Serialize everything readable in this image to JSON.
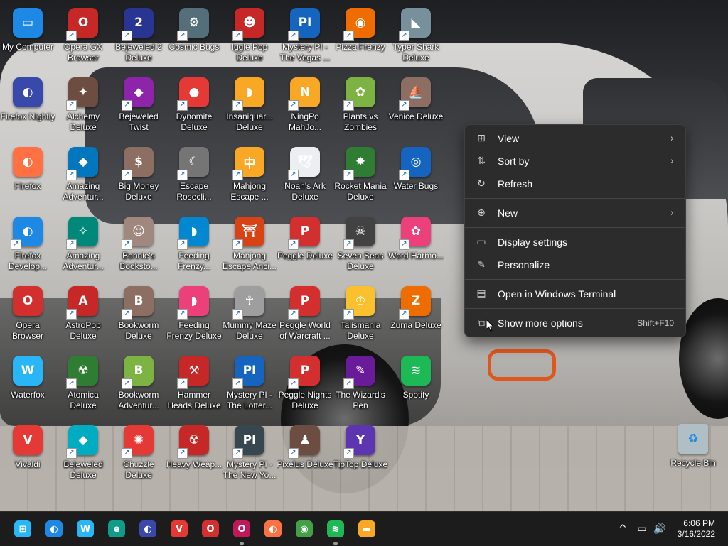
{
  "desktop": {
    "icons": [
      {
        "label": "My Computer",
        "color": "#1e88e5",
        "glyph": "▭",
        "shortcut": false
      },
      {
        "label": "Opera GX Browser",
        "color": "#c62828",
        "glyph": "O",
        "shortcut": true
      },
      {
        "label": "Bejeweled 2 Deluxe",
        "color": "#283593",
        "glyph": "2",
        "shortcut": true
      },
      {
        "label": "Cosmic Bugs",
        "color": "#546e7a",
        "glyph": "⚙",
        "shortcut": true
      },
      {
        "label": "Iggle Pop Deluxe",
        "color": "#c62828",
        "glyph": "☻",
        "shortcut": true
      },
      {
        "label": "Mystery PI - The Vegas ...",
        "color": "#1565c0",
        "glyph": "PI",
        "shortcut": true
      },
      {
        "label": "Pizza Frenzy",
        "color": "#ef6c00",
        "glyph": "◉",
        "shortcut": true
      },
      {
        "label": "Typer Shark Deluxe",
        "color": "#78909c",
        "glyph": "◣",
        "shortcut": true
      },
      {
        "label": "Firefox Nightly",
        "color": "#3949ab",
        "glyph": "◐",
        "shortcut": false
      },
      {
        "label": "Alchemy Deluxe",
        "color": "#6d4c41",
        "glyph": "✦",
        "shortcut": true
      },
      {
        "label": "Bejeweled Twist",
        "color": "#8e24aa",
        "glyph": "◆",
        "shortcut": true
      },
      {
        "label": "Dynomite Deluxe",
        "color": "#e53935",
        "glyph": "●",
        "shortcut": true
      },
      {
        "label": "Insaniquar... Deluxe",
        "color": "#f9a825",
        "glyph": "◗",
        "shortcut": true
      },
      {
        "label": "NingPo MahJo...",
        "color": "#f9a825",
        "glyph": "N",
        "shortcut": true
      },
      {
        "label": "Plants vs Zombies",
        "color": "#7cb342",
        "glyph": "✿",
        "shortcut": true
      },
      {
        "label": "Venice Deluxe",
        "color": "#8d6e63",
        "glyph": "⛵",
        "shortcut": true
      },
      {
        "label": "Firefox",
        "color": "#ff7043",
        "glyph": "◐",
        "shortcut": false
      },
      {
        "label": "Amazing Adventur...",
        "color": "#0277bd",
        "glyph": "◆",
        "shortcut": true
      },
      {
        "label": "Big Money Deluxe",
        "color": "#8d6e63",
        "glyph": "$",
        "shortcut": true
      },
      {
        "label": "Escape Rosecli...",
        "color": "#757575",
        "glyph": "☾",
        "shortcut": true
      },
      {
        "label": "Mahjong Escape ...",
        "color": "#f9a825",
        "glyph": "中",
        "shortcut": true
      },
      {
        "label": "Noah's Ark Deluxe",
        "color": "#eceff1",
        "glyph": "🕊",
        "shortcut": true
      },
      {
        "label": "Rocket Mania Deluxe",
        "color": "#2e7d32",
        "glyph": "✸",
        "shortcut": true
      },
      {
        "label": "Water Bugs",
        "color": "#1565c0",
        "glyph": "◎",
        "shortcut": true
      },
      {
        "label": "Firefox Develop...",
        "color": "#1e88e5",
        "glyph": "◐",
        "shortcut": true
      },
      {
        "label": "Amazing Adventur...",
        "color": "#00897b",
        "glyph": "✧",
        "shortcut": true
      },
      {
        "label": "Bonnie's Bookstо...",
        "color": "#a1887f",
        "glyph": "☺",
        "shortcut": true
      },
      {
        "label": "Feeding Frenzy...",
        "color": "#0288d1",
        "glyph": "◗",
        "shortcut": true
      },
      {
        "label": "Mahjong Escape Anci...",
        "color": "#d84315",
        "glyph": "⛩",
        "shortcut": true
      },
      {
        "label": "Peggle Deluxe",
        "color": "#d32f2f",
        "glyph": "P",
        "shortcut": true
      },
      {
        "label": "Seven Seas Deluxe",
        "color": "#424242",
        "glyph": "☠",
        "shortcut": true
      },
      {
        "label": "Word Harmo...",
        "color": "#ec407a",
        "glyph": "✿",
        "shortcut": true
      },
      {
        "label": "Opera Browser",
        "color": "#d32f2f",
        "glyph": "O",
        "shortcut": false
      },
      {
        "label": "AstroPop Deluxe",
        "color": "#c62828",
        "glyph": "A",
        "shortcut": true
      },
      {
        "label": "Bookworm Deluxe",
        "color": "#8d6e63",
        "glyph": "B",
        "shortcut": true
      },
      {
        "label": "Feeding Frenzy Deluxe",
        "color": "#ec407a",
        "glyph": "◗",
        "shortcut": true
      },
      {
        "label": "Mummy Maze Deluxe",
        "color": "#9e9e9e",
        "glyph": "☥",
        "shortcut": true
      },
      {
        "label": "Peggle World of Warcraft ...",
        "color": "#d32f2f",
        "glyph": "P",
        "shortcut": true
      },
      {
        "label": "Talismania Deluxe",
        "color": "#fbc02d",
        "glyph": "♔",
        "shortcut": true
      },
      {
        "label": "Zuma Deluxe",
        "color": "#ef6c00",
        "glyph": "Z",
        "shortcut": true
      },
      {
        "label": "Waterfox",
        "color": "#29b6f6",
        "glyph": "W",
        "shortcut": false
      },
      {
        "label": "Atomica Deluxe",
        "color": "#2e7d32",
        "glyph": "☢",
        "shortcut": true
      },
      {
        "label": "Bookworm Adventur...",
        "color": "#7cb342",
        "glyph": "B",
        "shortcut": true
      },
      {
        "label": "Hammer Heads Deluxe",
        "color": "#c62828",
        "glyph": "⚒",
        "shortcut": true
      },
      {
        "label": "Mystery PI - The Lotter...",
        "color": "#1565c0",
        "glyph": "PI",
        "shortcut": true
      },
      {
        "label": "Peggle Nights Deluxe",
        "color": "#d32f2f",
        "glyph": "P",
        "shortcut": true
      },
      {
        "label": "The Wizard's Pen",
        "color": "#6a1b9a",
        "glyph": "✎",
        "shortcut": true
      },
      {
        "label": "Spotify",
        "color": "#1db954",
        "glyph": "≋",
        "shortcut": false
      },
      {
        "label": "Vivaldi",
        "color": "#e53935",
        "glyph": "V",
        "shortcut": false
      },
      {
        "label": "Bejeweled Deluxe",
        "color": "#00acc1",
        "glyph": "◆",
        "shortcut": true
      },
      {
        "label": "Chuzzle Deluxe",
        "color": "#e53935",
        "glyph": "✺",
        "shortcut": true
      },
      {
        "label": "Heavy Weap...",
        "color": "#c62828",
        "glyph": "☢",
        "shortcut": true
      },
      {
        "label": "Mystery PI - The New Yo...",
        "color": "#37474f",
        "glyph": "PI",
        "shortcut": true
      },
      {
        "label": "Pixelus Deluxe",
        "color": "#6d4c41",
        "glyph": "♟",
        "shortcut": true
      },
      {
        "label": "TipTop Deluxe",
        "color": "#5e35b1",
        "glyph": "Y",
        "shortcut": true
      }
    ],
    "recycle_bin": {
      "label": "Recycle Bin",
      "color": "#b0bec5",
      "glyph": "♻"
    }
  },
  "context_menu": {
    "items": [
      {
        "label": "View",
        "icon": "view-icon",
        "glyph": "⊞",
        "submenu": true
      },
      {
        "label": "Sort by",
        "icon": "sort-icon",
        "glyph": "⇅",
        "submenu": true
      },
      {
        "label": "Refresh",
        "icon": "refresh-icon",
        "glyph": "↻",
        "submenu": false
      },
      {
        "label": "New",
        "icon": "new-icon",
        "glyph": "⊕",
        "submenu": true
      },
      {
        "label": "Display settings",
        "icon": "display-icon",
        "glyph": "▭",
        "submenu": false
      },
      {
        "label": "Personalize",
        "icon": "pen-icon",
        "glyph": "✎",
        "submenu": false
      },
      {
        "label": "Open in Windows Terminal",
        "icon": "terminal-icon",
        "glyph": "▤",
        "submenu": false
      },
      {
        "label": "Show more options",
        "icon": "more-options-icon",
        "glyph": "⧉",
        "submenu": false,
        "shortcut": "Shift+F10"
      }
    ]
  },
  "taskbar": {
    "apps": [
      {
        "name": "start",
        "glyph": "⊞",
        "color": "#29b6f6",
        "running": false
      },
      {
        "name": "firefox-developer",
        "glyph": "◐",
        "color": "#1e88e5",
        "running": false
      },
      {
        "name": "waterfox",
        "glyph": "W",
        "color": "#29b6f6",
        "running": false
      },
      {
        "name": "edge",
        "glyph": "e",
        "color": "#0f9d8a",
        "running": false
      },
      {
        "name": "firefox-nightly",
        "glyph": "◐",
        "color": "#3949ab",
        "running": false
      },
      {
        "name": "vivaldi",
        "glyph": "V",
        "color": "#e53935",
        "running": false
      },
      {
        "name": "opera",
        "glyph": "O",
        "color": "#d32f2f",
        "running": false
      },
      {
        "name": "opera-gx",
        "glyph": "O",
        "color": "#c2185b",
        "running": true
      },
      {
        "name": "firefox",
        "glyph": "◐",
        "color": "#ff7043",
        "running": false
      },
      {
        "name": "chrome",
        "glyph": "◉",
        "color": "#43a047",
        "running": false
      },
      {
        "name": "spotify",
        "glyph": "≋",
        "color": "#1db954",
        "running": true
      },
      {
        "name": "file-explorer",
        "glyph": "▬",
        "color": "#f9a825",
        "running": false
      }
    ],
    "tray": {
      "chevron": "^",
      "network": "▭",
      "volume": "🔊"
    },
    "clock": {
      "time": "6:06 PM",
      "date": "3/16/2022"
    }
  }
}
